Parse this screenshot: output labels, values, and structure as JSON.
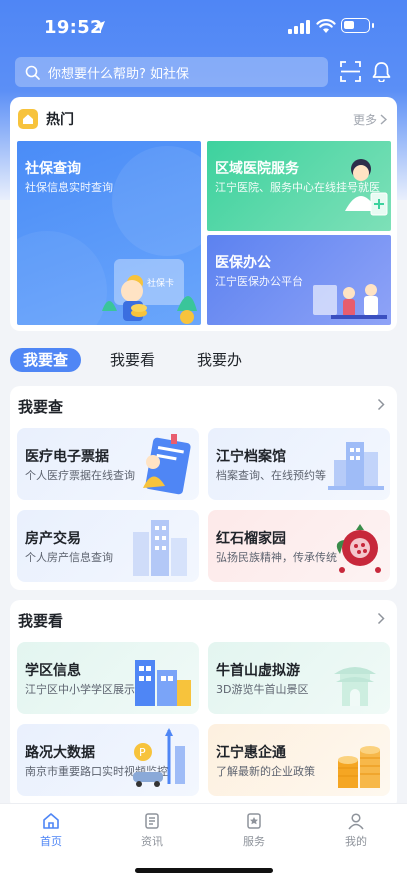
{
  "status_bar": {
    "time": "19:52"
  },
  "search": {
    "placeholder": "你想要什么帮助? 如社保"
  },
  "hot": {
    "title": "热门",
    "more": "更多",
    "tiles": [
      {
        "title": "社保查询",
        "subtitle": "社保信息实时查询",
        "card_label": "社保卡"
      },
      {
        "title": "区域医院服务",
        "subtitle": "江宁医院、服务中心在线挂号就医"
      },
      {
        "title": "医保办公",
        "subtitle": "江宁医保办公平台"
      }
    ]
  },
  "tabs": [
    {
      "label": "我要查"
    },
    {
      "label": "我要看"
    },
    {
      "label": "我要办"
    }
  ],
  "section_query": {
    "title": "我要查",
    "items": [
      {
        "title": "医疗电子票据",
        "subtitle": "个人医疗票据在线查询"
      },
      {
        "title": "江宁档案馆",
        "subtitle": "档案查询、在线预约等"
      },
      {
        "title": "房产交易",
        "subtitle": "个人房产信息查询"
      },
      {
        "title": "红石榴家园",
        "subtitle": "弘扬民族精神，传承传统"
      }
    ]
  },
  "section_view": {
    "title": "我要看",
    "items": [
      {
        "title": "学区信息",
        "subtitle": "江宁区中小学学区展示"
      },
      {
        "title": "牛首山虚拟游",
        "subtitle": "3D游览牛首山景区"
      },
      {
        "title": "路况大数据",
        "subtitle": "南京市重要路口实时视频监控"
      },
      {
        "title": "江宁惠企通",
        "subtitle": "了解最新的企业政策"
      }
    ]
  },
  "tabbar": [
    {
      "label": "首页",
      "icon": "home-icon"
    },
    {
      "label": "资讯",
      "icon": "news-icon"
    },
    {
      "label": "服务",
      "icon": "service-icon"
    },
    {
      "label": "我的",
      "icon": "user-icon"
    }
  ],
  "colors": {
    "primary": "#4f86f5",
    "hot_icon": "#f7c33c",
    "tab_active": "#4f86f5"
  }
}
